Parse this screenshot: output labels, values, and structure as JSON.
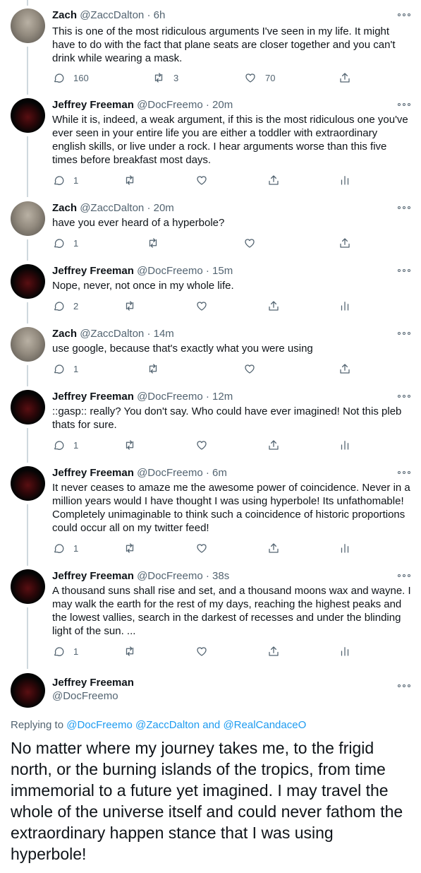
{
  "thread": [
    {
      "author": "Zach",
      "handle": "@ZaccDalton",
      "time": "6h",
      "avatar": "zach",
      "text": "This is one of the most ridiculous arguments I've seen in my life. It might have to do with the fact that plane seats are closer together and you can't drink while wearing a mask.",
      "replies": "160",
      "retweets": "3",
      "likes": "70",
      "analytics": false
    },
    {
      "author": "Jeffrey Freeman",
      "handle": "@DocFreemo",
      "time": "20m",
      "avatar": "jeff",
      "text": "While it is, indeed, a weak argument, if this is the most ridiculous one you've ever seen in your entire life you are either a toddler with extraordinary english skills, or live under a rock. I hear arguments worse than this five times before breakfast most days.",
      "replies": "1",
      "retweets": "",
      "likes": "",
      "analytics": true
    },
    {
      "author": "Zach",
      "handle": "@ZaccDalton",
      "time": "20m",
      "avatar": "zach",
      "text": "have you ever heard of a hyperbole?",
      "replies": "1",
      "retweets": "",
      "likes": "",
      "analytics": false
    },
    {
      "author": "Jeffrey Freeman",
      "handle": "@DocFreemo",
      "time": "15m",
      "avatar": "jeff",
      "text": "Nope, never, not once in my whole life.",
      "replies": "2",
      "retweets": "",
      "likes": "",
      "analytics": true
    },
    {
      "author": "Zach",
      "handle": "@ZaccDalton",
      "time": "14m",
      "avatar": "zach",
      "text": "use google, because that's exactly what you were using",
      "replies": "1",
      "retweets": "",
      "likes": "",
      "analytics": false
    },
    {
      "author": "Jeffrey Freeman",
      "handle": "@DocFreemo",
      "time": "12m",
      "avatar": "jeff",
      "text": "::gasp:: really? You don't say. Who could have ever imagined! Not this pleb thats for sure.",
      "replies": "1",
      "retweets": "",
      "likes": "",
      "analytics": true
    },
    {
      "author": "Jeffrey Freeman",
      "handle": "@DocFreemo",
      "time": "6m",
      "avatar": "jeff",
      "text": "It never ceases to amaze me the awesome power of coincidence. Never in a million years would I have thought I was using hyperbole! Its unfathomable! Completely unimaginable to think such a coincidence of historic proportions could occur all on my twitter feed!",
      "replies": "1",
      "retweets": "",
      "likes": "",
      "analytics": true
    },
    {
      "author": "Jeffrey Freeman",
      "handle": "@DocFreemo",
      "time": "38s",
      "avatar": "jeff",
      "text": "A thousand suns shall rise and set, and a thousand moons wax and wayne. I may walk the earth for the rest of my days, reaching the highest peaks and the lowest vallies, search in the darkest of recesses and under the blinding light of the sun. ...",
      "replies": "1",
      "retweets": "",
      "likes": "",
      "analytics": true
    }
  ],
  "main_tweet": {
    "author": "Jeffrey Freeman",
    "handle": "@DocFreemo",
    "replying_prefix": "Replying to",
    "replying_to_1": "@DocFreemo",
    "replying_to_2": "@ZaccDalton",
    "replying_and": "and",
    "replying_to_3": "@RealCandaceO",
    "text": "No matter where my journey takes me, to the frigid north, or the burning islands of the tropics, from time immemorial to a future yet imagined. I may travel the whole of the universe itself and could never fathom the extraordinary happen stance that I was using hyperbole!"
  },
  "colors": {
    "text": "#0f1419",
    "secondary": "#536471",
    "link": "#1d9bf0",
    "thread_line": "#cfd9de"
  },
  "icons": [
    "reply-icon",
    "retweet-icon",
    "like-icon",
    "share-icon",
    "analytics-icon",
    "more-icon"
  ]
}
